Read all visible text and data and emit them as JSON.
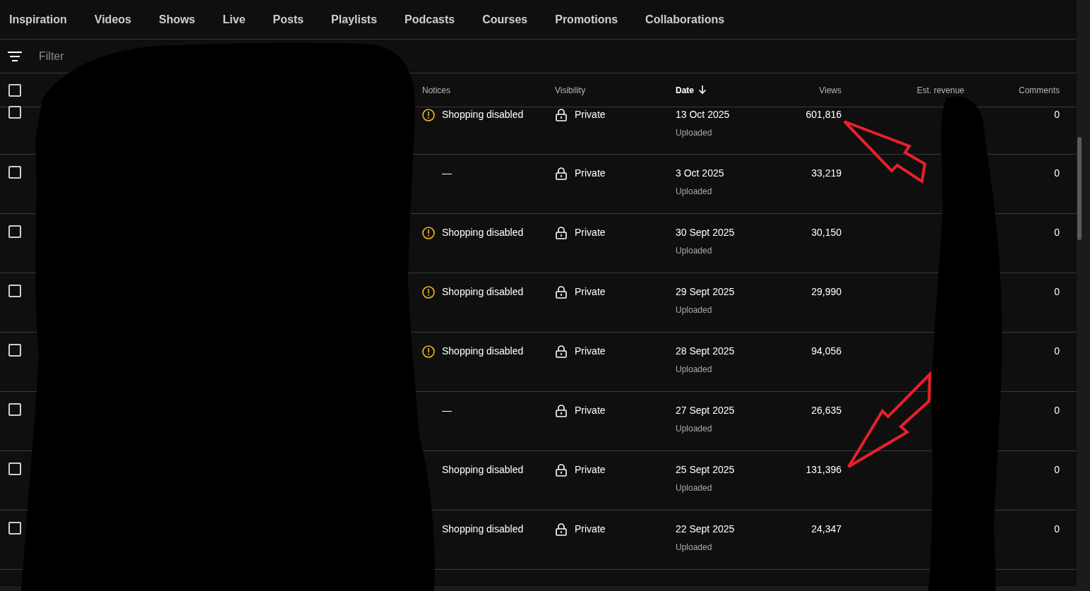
{
  "tabs": [
    {
      "label": "Inspiration",
      "selected": false
    },
    {
      "label": "Videos",
      "selected": false
    },
    {
      "label": "Shows",
      "selected": false
    },
    {
      "label": "Live",
      "selected": false
    },
    {
      "label": "Posts",
      "selected": false
    },
    {
      "label": "Playlists",
      "selected": false
    },
    {
      "label": "Podcasts",
      "selected": false
    },
    {
      "label": "Courses",
      "selected": false
    },
    {
      "label": "Promotions",
      "selected": false
    },
    {
      "label": "Collaborations",
      "selected": false
    }
  ],
  "filter": {
    "placeholder": "Filter"
  },
  "table": {
    "select_all": {
      "checked": false
    },
    "columns": [
      {
        "label": "Notices",
        "sorted": false
      },
      {
        "label": "Visibility",
        "sorted": false
      },
      {
        "label": "Date",
        "sorted": true
      },
      {
        "label": "Views",
        "sorted": false
      },
      {
        "label": "Est. revenue",
        "sorted": false
      },
      {
        "label": "Comments",
        "sorted": false
      }
    ],
    "rows": [
      {
        "checked": false,
        "notice": "Shopping disabled",
        "warning": true,
        "visibility": "Private",
        "date": "13 Oct 2025",
        "status": "Uploaded",
        "views": "601,816",
        "comments": "0"
      },
      {
        "checked": false,
        "notice": "—",
        "warning": false,
        "visibility": "Private",
        "date": "3 Oct 2025",
        "status": "Uploaded",
        "views": "33,219",
        "comments": "0"
      },
      {
        "checked": false,
        "notice": "Shopping disabled",
        "warning": true,
        "visibility": "Private",
        "date": "30 Sept 2025",
        "status": "Uploaded",
        "views": "30,150",
        "comments": "0"
      },
      {
        "checked": false,
        "notice": "Shopping disabled",
        "warning": true,
        "visibility": "Private",
        "date": "29 Sept 2025",
        "status": "Uploaded",
        "views": "29,990",
        "comments": "0"
      },
      {
        "checked": false,
        "notice": "Shopping disabled",
        "warning": true,
        "visibility": "Private",
        "date": "28 Sept 2025",
        "status": "Uploaded",
        "views": "94,056",
        "comments": "0"
      },
      {
        "checked": false,
        "notice": "—",
        "warning": false,
        "visibility": "Private",
        "date": "27 Sept 2025",
        "status": "Uploaded",
        "views": "26,635",
        "comments": "0"
      },
      {
        "checked": false,
        "notice": "Shopping disabled",
        "warning": false,
        "visibility": "Private",
        "date": "25 Sept 2025",
        "status": "Uploaded",
        "views": "131,396",
        "comments": "0"
      },
      {
        "checked": false,
        "notice": "Shopping disabled",
        "warning": false,
        "visibility": "Private",
        "date": "22 Sept 2025",
        "status": "Uploaded",
        "views": "24,347",
        "comments": "0"
      }
    ]
  }
}
